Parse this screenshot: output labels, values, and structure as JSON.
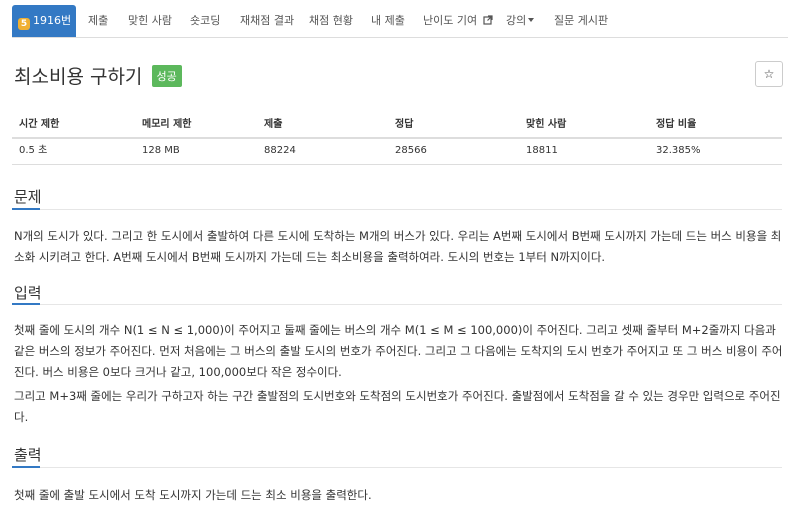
{
  "nav": {
    "problem_tab": {
      "tier": "5",
      "label": "1916번"
    },
    "items": [
      {
        "label": "제출"
      },
      {
        "label": "맞힌 사람"
      },
      {
        "label": "숏코딩"
      },
      {
        "label": "재채점 결과"
      },
      {
        "label": "채점 현황"
      },
      {
        "label": "내 제출"
      },
      {
        "label": "난이도 기여"
      },
      {
        "label": "강의"
      },
      {
        "label": "질문 게시판"
      }
    ],
    "icons": {
      "difficulty": "external-link-icon",
      "lecture": "caret-down-icon"
    }
  },
  "problem": {
    "title": "최소비용 구하기",
    "status_badge": "성공",
    "star": "☆"
  },
  "stats": {
    "headers": [
      "시간 제한",
      "메모리 제한",
      "제출",
      "정답",
      "맞힌 사람",
      "정답 비율"
    ],
    "values": [
      "0.5 초",
      "128 MB",
      "88224",
      "28566",
      "18811",
      "32.385%"
    ]
  },
  "sections": {
    "problem": {
      "heading": "문제",
      "body": "N개의 도시가 있다. 그리고 한 도시에서 출발하여 다른 도시에 도착하는 M개의 버스가 있다. 우리는 A번째 도시에서 B번째 도시까지 가는데 드는 버스 비용을 최소화 시키려고 한다. A번째 도시에서 B번째 도시까지 가는데 드는 최소비용을 출력하여라. 도시의 번호는 1부터 N까지이다."
    },
    "input": {
      "heading": "입력",
      "body1": "첫째 줄에 도시의 개수 N(1 ≤ N ≤ 1,000)이 주어지고 둘째 줄에는 버스의 개수 M(1 ≤ M ≤ 100,000)이 주어진다. 그리고 셋째 줄부터 M+2줄까지 다음과 같은 버스의 정보가 주어진다. 먼저 처음에는 그 버스의 출발 도시의 번호가 주어진다. 그리고 그 다음에는 도착지의 도시 번호가 주어지고 또 그 버스 비용이 주어진다. 버스 비용은 0보다 크거나 같고, 100,000보다 작은 정수이다.",
      "body2": "그리고 M+3째 줄에는 우리가 구하고자 하는 구간 출발점의 도시번호와 도착점의 도시번호가 주어진다. 출발점에서 도착점을 갈 수 있는 경우만 입력으로 주어진다."
    },
    "output": {
      "heading": "출력",
      "body": "첫째 줄에 출발 도시에서 도착 도시까지 가는데 드는 최소 비용을 출력한다."
    }
  },
  "colors": {
    "accent": "#3379c4",
    "success": "#5cb85c",
    "tier": "#f0b032"
  }
}
